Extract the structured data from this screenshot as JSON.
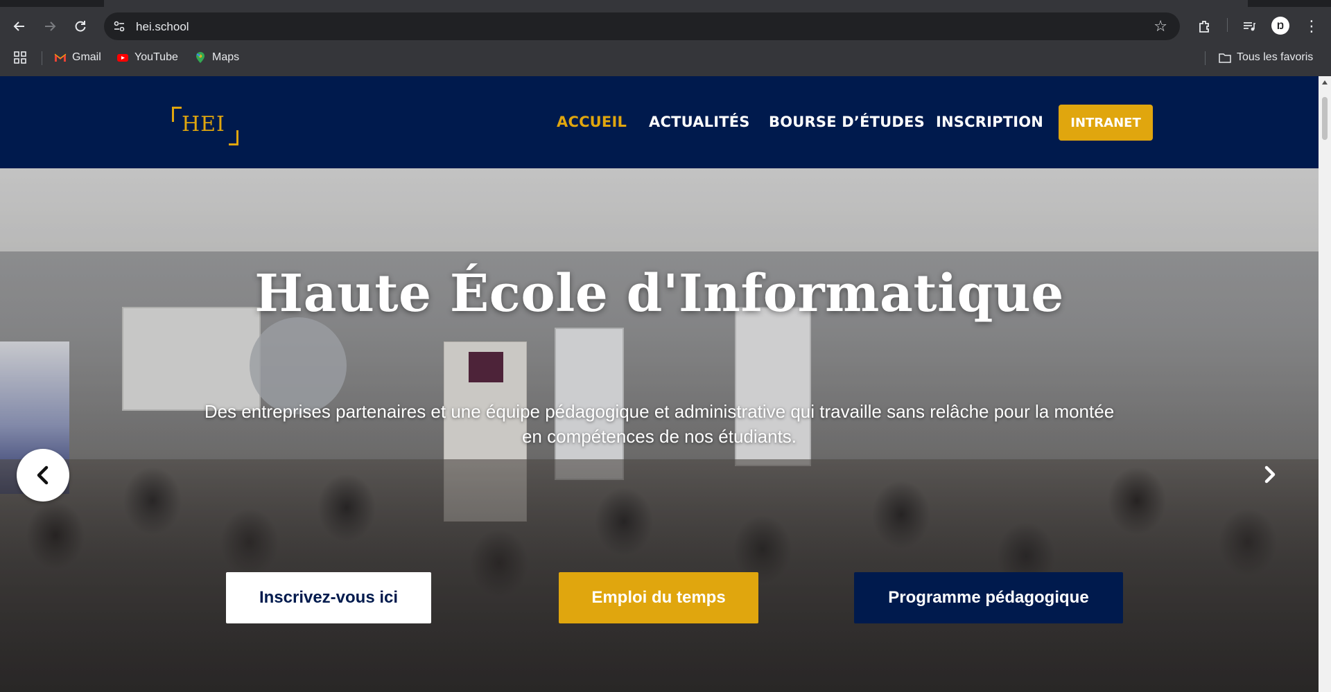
{
  "browser": {
    "url": "hei.school",
    "bookmarks": [
      {
        "label": "Gmail",
        "icon": "gmail-icon"
      },
      {
        "label": "YouTube",
        "icon": "youtube-icon"
      },
      {
        "label": "Maps",
        "icon": "maps-icon"
      }
    ],
    "all_bookmarks_label": "Tous les favoris",
    "profile_initial": "Ŋ"
  },
  "site": {
    "logo_text": "HEI",
    "nav": [
      {
        "label": "ACCUEIL",
        "active": true
      },
      {
        "label": "ACTUALITÉS",
        "active": false
      },
      {
        "label": "BOURSE D’ÉTUDES",
        "active": false
      },
      {
        "label": "INSCRIPTION",
        "active": false
      }
    ],
    "intranet_label": "INTRANET",
    "colors": {
      "navy": "#001a4d",
      "gold": "#e0a60e",
      "white": "#ffffff"
    }
  },
  "hero": {
    "title": "Haute École d'Informatique",
    "subtitle": "Des entreprises partenaires et une équipe pédagogique et administrative qui travaille sans relâche pour la montée en compétences de nos étudiants.",
    "buttons": {
      "register": "Inscrivez-vous ici",
      "schedule": "Emploi du temps",
      "program": "Programme pédagogique"
    }
  }
}
